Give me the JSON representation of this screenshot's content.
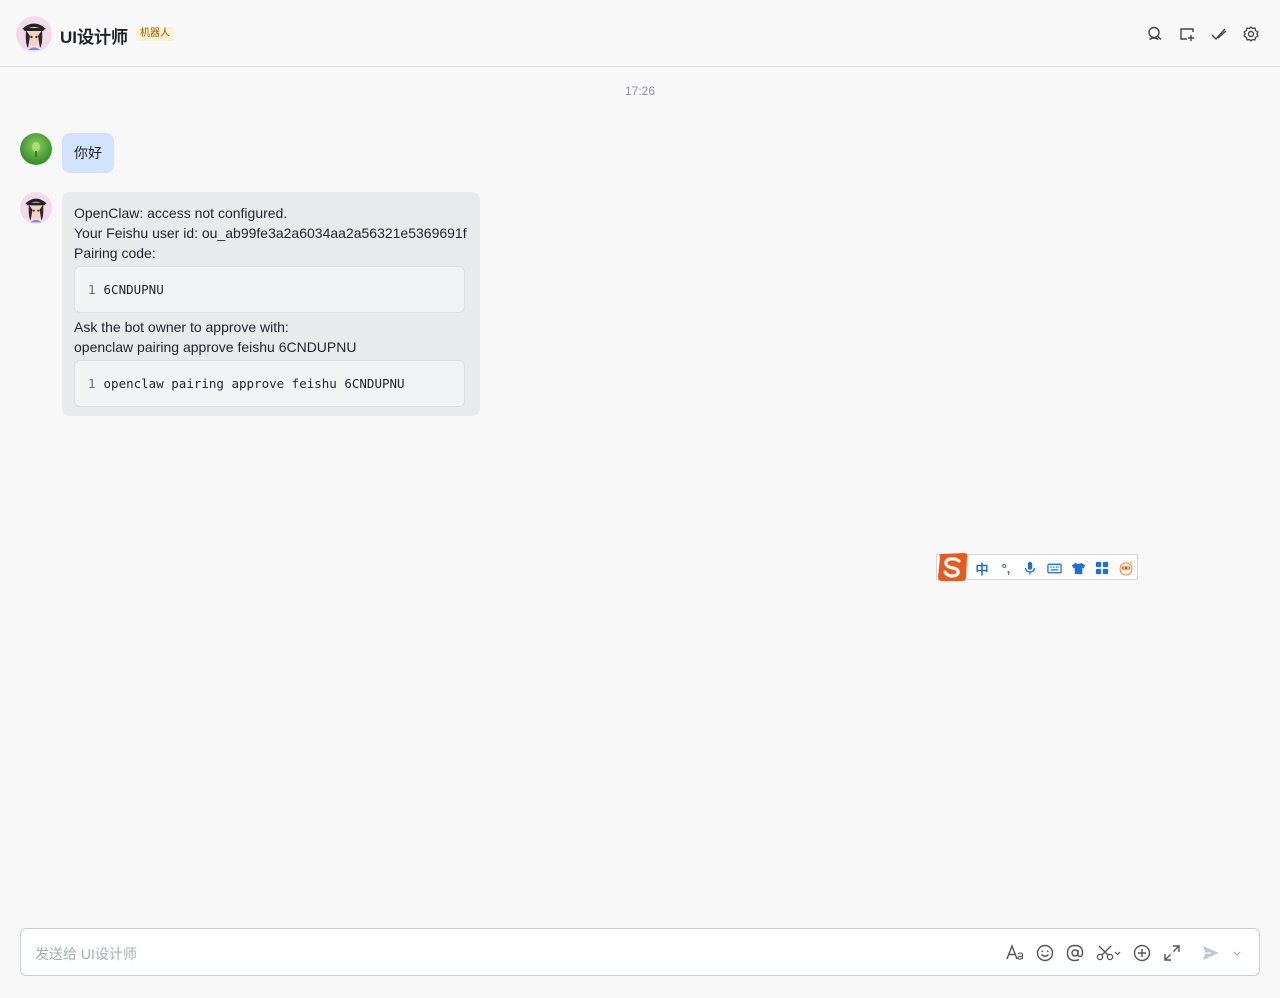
{
  "header": {
    "title": "UI设计师",
    "badge": "机器人",
    "icons": [
      "search-icon",
      "add-tab-icon",
      "tasks-check-icon",
      "settings-gear-icon"
    ]
  },
  "chat": {
    "timestamp": "17:26",
    "user_message": "你好",
    "bot_message": {
      "line1": "OpenClaw: access not configured.",
      "line2": "Your Feishu user id: ou_ab99fe3a2a6034aa2a56321e5369691f",
      "line3": "Pairing code:",
      "code1_line_no": "1",
      "code1": "6CNDUPNU",
      "line4": "Ask the bot owner to approve with:",
      "line5": "openclaw pairing approve feishu 6CNDUPNU",
      "code2_line_no": "1",
      "code2": "openclaw pairing approve feishu 6CNDUPNU"
    }
  },
  "ime_toolbar": {
    "mode": "中",
    "punct": "°,"
  },
  "composer": {
    "placeholder": "发送给 UI设计师",
    "tools": [
      "text-format-icon",
      "emoji-icon",
      "mention-icon",
      "screenshot-scissors-icon",
      "plus-circle-icon",
      "expand-icon",
      "send-icon",
      "dropdown-chevron-icon"
    ]
  }
}
